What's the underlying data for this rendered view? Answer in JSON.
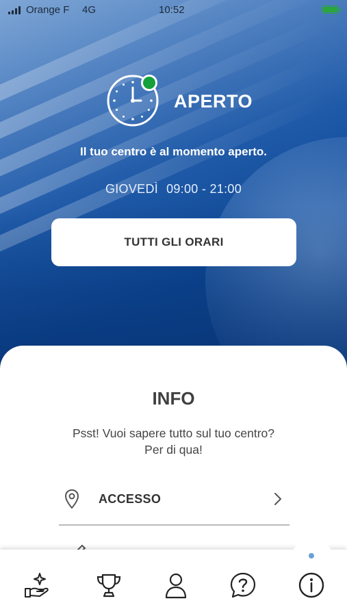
{
  "status_bar": {
    "carrier": "Orange F",
    "network": "4G",
    "time": "10:52"
  },
  "center_status": {
    "status": "APERTO",
    "description": "Il tuo centro è al momento aperto.",
    "day": "GIOVEDÌ",
    "hours": "09:00 - 21:00",
    "all_hours_button": "TUTTI GLI ORARI",
    "status_color": "#14a03a"
  },
  "info": {
    "title": "INFO",
    "subtitle_line1": "Psst! Vuoi sapere tutto sul tuo centro?",
    "subtitle_line2": "Per di qua!",
    "rows": [
      {
        "label": "ACCESSO",
        "icon": "location-pin-icon"
      },
      {
        "label": "",
        "icon": "pen-icon"
      }
    ]
  },
  "tab_bar": {
    "tabs": [
      {
        "name": "rewards",
        "icon": "hand-sparkle-icon"
      },
      {
        "name": "challenges",
        "icon": "trophy-icon"
      },
      {
        "name": "profile",
        "icon": "person-icon"
      },
      {
        "name": "help",
        "icon": "question-bubble-icon"
      },
      {
        "name": "info",
        "icon": "info-icon",
        "active": true
      }
    ],
    "active_indicator_color": "#6b9fd6"
  }
}
